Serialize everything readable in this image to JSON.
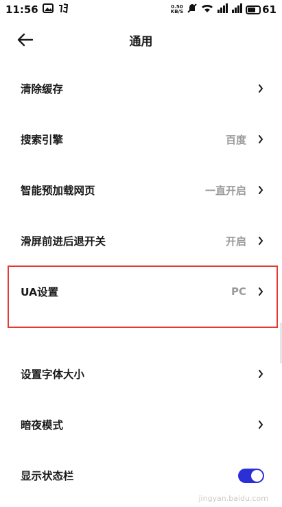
{
  "status": {
    "time": "11:56",
    "speed_top": "0.50",
    "speed_bottom": "KB/S",
    "battery": "61"
  },
  "header": {
    "title": "通用"
  },
  "settings": [
    {
      "label": "清除缓存",
      "value": ""
    },
    {
      "label": "搜索引擎",
      "value": "百度"
    },
    {
      "label": "智能预加载网页",
      "value": "一直开启"
    },
    {
      "label": "滑屏前进后退开关",
      "value": "开启"
    },
    {
      "label": "UA设置",
      "value": "PC"
    },
    {
      "label": "设置字体大小",
      "value": ""
    },
    {
      "label": "暗夜模式",
      "value": ""
    },
    {
      "label": "显示状态栏",
      "toggle": true
    }
  ],
  "colors": {
    "accent": "#2b2fd6",
    "highlight": "#e53935",
    "value_text": "#9a9a9a"
  },
  "watermark": "jingyan.baidu.com"
}
